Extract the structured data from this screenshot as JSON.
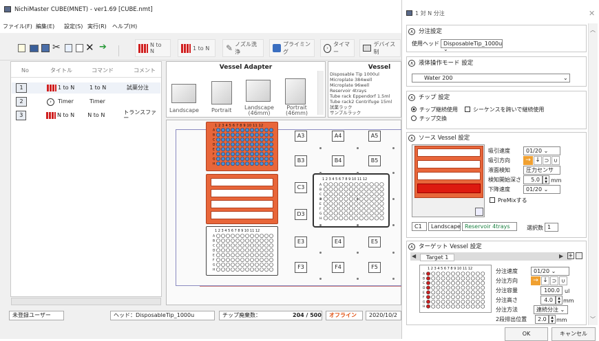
{
  "main": {
    "title": "NichiMaster CUBE(MNET) - ver1.69 [CUBE.nmt]",
    "menu": [
      "ファイル(F)",
      "編集(E)",
      "設定(S)",
      "実行(R)",
      "ヘルプ(H)"
    ],
    "toolbar": {
      "n_to_n": "N to N",
      "one_to_n": "1 to N",
      "nozzle_wash": "ノズル洗浄",
      "priming": "プライミング",
      "timer": "タイマー",
      "device": "デバイス制"
    },
    "list_headers": [
      "No",
      "タイトル",
      "コマンド",
      "コメント"
    ],
    "rows": [
      {
        "no": "1",
        "title": "1 to N",
        "command": "1 to N",
        "comment": "試薬分注"
      },
      {
        "no": "2",
        "title": "Timer",
        "command": "Timer",
        "comment": ""
      },
      {
        "no": "3",
        "title": "N to N",
        "command": "N to N",
        "comment": "トランスファー"
      }
    ],
    "vessel_adapter": {
      "header": "Vessel Adapter",
      "items": [
        "Landscape",
        "Portrait",
        "Landscape\n(46mm)",
        "Portrait\n(46mm)"
      ]
    },
    "vessel": {
      "header": "Vessel",
      "items": [
        "Disposable Tip 1000ul",
        "Microplate 384well",
        "Microplate 96well",
        "Reservoir 4trays",
        "Tube rack Eppendorf 1.5ml",
        "Tube rack2 Centrifuge 15ml",
        "試薬ラック",
        "サンプルラック"
      ]
    },
    "deck_slots": [
      "A3",
      "A4",
      "A5",
      "B3",
      "B4",
      "B5",
      "C3",
      "D3",
      "E3",
      "E4",
      "E5",
      "F3",
      "F4",
      "F5"
    ],
    "plate_cols": "1 2 3 4 5 6 7 8 9 10 11 12",
    "plate_rows": [
      "A",
      "B",
      "C",
      "D",
      "E",
      "F",
      "G",
      "H"
    ],
    "status": {
      "user": "未登録ユーザー",
      "head": "ヘッド：DisposableTip_1000u",
      "tip_label": "チップ廃棄数：",
      "tip_count": "204 / 500",
      "offline": "オフライン",
      "date": "2020/10/2"
    }
  },
  "dialog": {
    "title": "1 対 N 分注",
    "sec1": {
      "title": "分注設定",
      "head_label": "使用ヘッド",
      "head_value": "DisposableTip_1000u"
    },
    "sec2": {
      "title": "液体操作モード 設定",
      "value": "Water 200"
    },
    "sec3": {
      "title": "チップ 設定",
      "opt1": "チップ継続使用",
      "chk": "シーケンスを跨いで継続使用",
      "opt2": "チップ交換"
    },
    "sec4": {
      "title": "ソース Vessel 設定",
      "aspirate_speed_label": "吸引速度",
      "aspirate_speed": "01/20",
      "aspirate_dir_label": "吸引方向",
      "level_detect_label": "液面検知",
      "level_detect": "圧力センサ",
      "detect_depth_label": "検知開始深さ",
      "detect_depth": "5.0",
      "detect_unit": "mm",
      "descend_label": "下降速度",
      "descend": "01/20",
      "premix": "PreMixする",
      "pos": "C1",
      "adapter": "Landscape",
      "vessel": "Reservoir 4trays",
      "select_count_label": "選択数",
      "select_count": "1"
    },
    "sec5": {
      "title": "ターゲット Vessel 設定",
      "tab": "Target 1",
      "dispense_speed_label": "分注速度",
      "dispense_speed": "01/20",
      "dispense_dir_label": "分注方向",
      "volume_label": "分注容量",
      "volume": "100.0",
      "volume_unit": "ul",
      "height_label": "分注高さ",
      "height": "4.0",
      "height_unit": "mm",
      "method_label": "分注方法",
      "method": "連続分注",
      "second_label": "2段排出位置",
      "second": "2.0",
      "second_unit": "mm"
    },
    "ok": "OK",
    "cancel": "キャンセル"
  },
  "colors": {
    "accent": "#e8663a",
    "selected_well": "#cc2020",
    "well": "#4a8fd4"
  }
}
